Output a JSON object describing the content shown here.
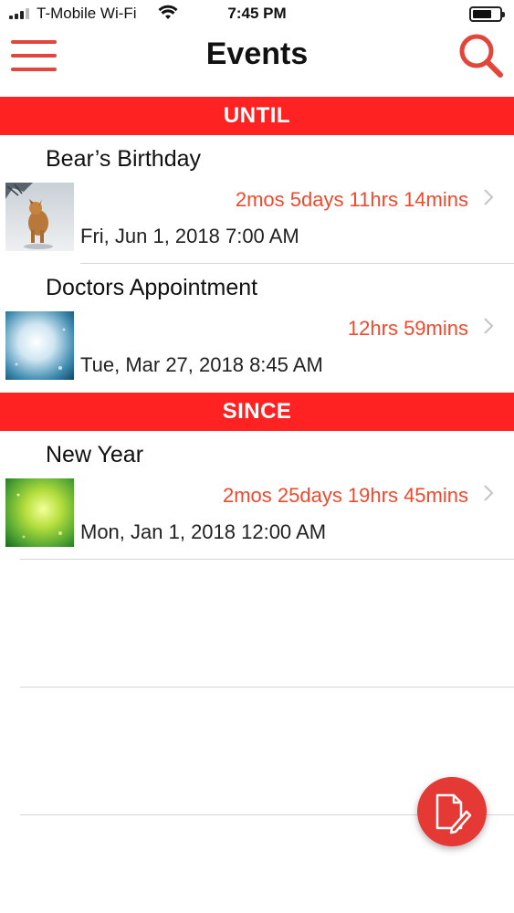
{
  "status_bar": {
    "carrier": "T-Mobile Wi-Fi",
    "time": "7:45 PM"
  },
  "nav": {
    "title": "Events",
    "menu_icon": "hamburger-menu-icon",
    "search_icon": "search-icon"
  },
  "sections": [
    {
      "header": "UNTIL",
      "events": [
        {
          "title": "Bear’s Birthday",
          "remaining": "2mos 5days 11hrs 14mins",
          "date": "Fri, Jun 1, 2018 7:00 AM",
          "thumbnail": "dog-in-snow-photo"
        },
        {
          "title": "Doctors Appointment",
          "remaining": "12hrs 59mins",
          "date": "Tue, Mar 27, 2018 8:45 AM",
          "thumbnail": "blue-bokeh-photo"
        }
      ]
    },
    {
      "header": "SINCE",
      "events": [
        {
          "title": "New Year",
          "remaining": "2mos 25days 19hrs 45mins",
          "date": "Mon, Jan 1, 2018 12:00 AM",
          "thumbnail": "green-bokeh-photo"
        }
      ]
    }
  ],
  "fab": {
    "icon": "new-document-edit-icon"
  },
  "colors": {
    "accent": "#ff2222",
    "countdown_text": "#ef4a2e",
    "fab": "#e53935"
  }
}
